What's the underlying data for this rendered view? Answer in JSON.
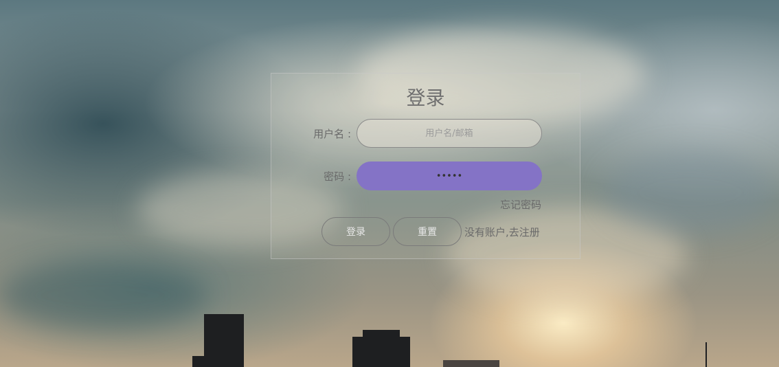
{
  "login": {
    "title": "登录",
    "username_label": "用户名 :",
    "username_placeholder": "用户名/邮箱",
    "password_label": "密码 :",
    "password_value": "•••••",
    "forgot_password": "忘记密码",
    "login_button": "登录",
    "reset_button": "重置",
    "register_link": "没有账户,去注册"
  },
  "colors": {
    "password_field": "#8473c6",
    "text": "#6a6a6a"
  }
}
